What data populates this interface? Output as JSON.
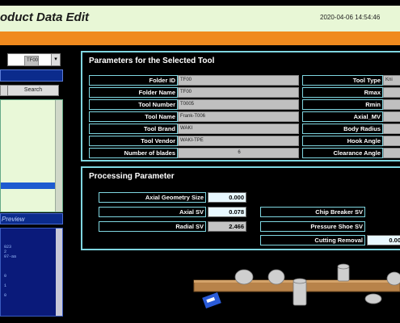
{
  "header": {
    "title": "oduct Data Edit",
    "datetime": "2020-04-06 14:54:46"
  },
  "left": {
    "folder_select": "TF00",
    "search_label": "Search",
    "preview_label": "Preview",
    "preview_lines": [
      "023",
      "2",
      "07-aa",
      "",
      "",
      "",
      "0",
      "",
      "1",
      "",
      "0"
    ]
  },
  "params": {
    "title": "Parameters for the Selected Tool",
    "left_rows": [
      {
        "label": "Folder ID",
        "value": "TF00"
      },
      {
        "label": "Folder Name",
        "value": "TF00"
      },
      {
        "label": "Tool Number",
        "value": "T0005"
      },
      {
        "label": "Tool Name",
        "value": "Frank-T006"
      },
      {
        "label": "Tool Brand",
        "value": "WAKI"
      },
      {
        "label": "Tool Vendor",
        "value": "WAKI-TPE"
      },
      {
        "label": "Number of blades",
        "value": "6"
      }
    ],
    "right_rows": [
      {
        "label": "Tool Type",
        "value": "Kni"
      },
      {
        "label": "Rmax",
        "value": ""
      },
      {
        "label": "Rmin",
        "value": ""
      },
      {
        "label": "Axial_MV",
        "value": ""
      },
      {
        "label": "Body Radius",
        "value": ""
      },
      {
        "label": "Hook Angle",
        "value": ""
      },
      {
        "label": "Clearance Angle",
        "value": ""
      }
    ]
  },
  "processing": {
    "title": "Processing Parameter",
    "left_rows": [
      {
        "label": "Axial Geometry Size",
        "value": "0.000"
      },
      {
        "label": "Axial SV",
        "value": "0.078"
      },
      {
        "label": "Radial SV",
        "value": "2.466"
      }
    ],
    "right_rows": [
      {
        "label": "Chip Breaker SV",
        "value": ""
      },
      {
        "label": "Pressure Shoe SV",
        "value": ""
      },
      {
        "label": "Cutting Removal",
        "value": "0.00"
      }
    ]
  },
  "colors": {
    "title_bg": "#e8f7d6",
    "accent_orange": "#f08a1e",
    "panel_border": "#7fd6e0",
    "input_bg_light": "#e8f8ff",
    "navy": "#0b2b8c"
  }
}
